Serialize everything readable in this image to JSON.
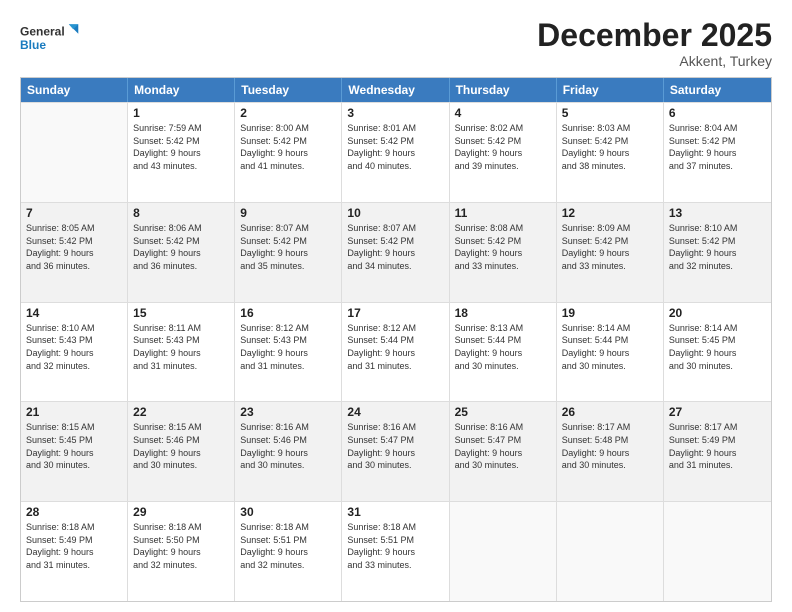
{
  "logo": {
    "text_general": "General",
    "text_blue": "Blue"
  },
  "title": "December 2025",
  "location": "Akkent, Turkey",
  "header_days": [
    "Sunday",
    "Monday",
    "Tuesday",
    "Wednesday",
    "Thursday",
    "Friday",
    "Saturday"
  ],
  "weeks": [
    [
      {
        "day": "",
        "lines": []
      },
      {
        "day": "1",
        "lines": [
          "Sunrise: 7:59 AM",
          "Sunset: 5:42 PM",
          "Daylight: 9 hours",
          "and 43 minutes."
        ]
      },
      {
        "day": "2",
        "lines": [
          "Sunrise: 8:00 AM",
          "Sunset: 5:42 PM",
          "Daylight: 9 hours",
          "and 41 minutes."
        ]
      },
      {
        "day": "3",
        "lines": [
          "Sunrise: 8:01 AM",
          "Sunset: 5:42 PM",
          "Daylight: 9 hours",
          "and 40 minutes."
        ]
      },
      {
        "day": "4",
        "lines": [
          "Sunrise: 8:02 AM",
          "Sunset: 5:42 PM",
          "Daylight: 9 hours",
          "and 39 minutes."
        ]
      },
      {
        "day": "5",
        "lines": [
          "Sunrise: 8:03 AM",
          "Sunset: 5:42 PM",
          "Daylight: 9 hours",
          "and 38 minutes."
        ]
      },
      {
        "day": "6",
        "lines": [
          "Sunrise: 8:04 AM",
          "Sunset: 5:42 PM",
          "Daylight: 9 hours",
          "and 37 minutes."
        ]
      }
    ],
    [
      {
        "day": "7",
        "lines": [
          "Sunrise: 8:05 AM",
          "Sunset: 5:42 PM",
          "Daylight: 9 hours",
          "and 36 minutes."
        ]
      },
      {
        "day": "8",
        "lines": [
          "Sunrise: 8:06 AM",
          "Sunset: 5:42 PM",
          "Daylight: 9 hours",
          "and 36 minutes."
        ]
      },
      {
        "day": "9",
        "lines": [
          "Sunrise: 8:07 AM",
          "Sunset: 5:42 PM",
          "Daylight: 9 hours",
          "and 35 minutes."
        ]
      },
      {
        "day": "10",
        "lines": [
          "Sunrise: 8:07 AM",
          "Sunset: 5:42 PM",
          "Daylight: 9 hours",
          "and 34 minutes."
        ]
      },
      {
        "day": "11",
        "lines": [
          "Sunrise: 8:08 AM",
          "Sunset: 5:42 PM",
          "Daylight: 9 hours",
          "and 33 minutes."
        ]
      },
      {
        "day": "12",
        "lines": [
          "Sunrise: 8:09 AM",
          "Sunset: 5:42 PM",
          "Daylight: 9 hours",
          "and 33 minutes."
        ]
      },
      {
        "day": "13",
        "lines": [
          "Sunrise: 8:10 AM",
          "Sunset: 5:42 PM",
          "Daylight: 9 hours",
          "and 32 minutes."
        ]
      }
    ],
    [
      {
        "day": "14",
        "lines": [
          "Sunrise: 8:10 AM",
          "Sunset: 5:43 PM",
          "Daylight: 9 hours",
          "and 32 minutes."
        ]
      },
      {
        "day": "15",
        "lines": [
          "Sunrise: 8:11 AM",
          "Sunset: 5:43 PM",
          "Daylight: 9 hours",
          "and 31 minutes."
        ]
      },
      {
        "day": "16",
        "lines": [
          "Sunrise: 8:12 AM",
          "Sunset: 5:43 PM",
          "Daylight: 9 hours",
          "and 31 minutes."
        ]
      },
      {
        "day": "17",
        "lines": [
          "Sunrise: 8:12 AM",
          "Sunset: 5:44 PM",
          "Daylight: 9 hours",
          "and 31 minutes."
        ]
      },
      {
        "day": "18",
        "lines": [
          "Sunrise: 8:13 AM",
          "Sunset: 5:44 PM",
          "Daylight: 9 hours",
          "and 30 minutes."
        ]
      },
      {
        "day": "19",
        "lines": [
          "Sunrise: 8:14 AM",
          "Sunset: 5:44 PM",
          "Daylight: 9 hours",
          "and 30 minutes."
        ]
      },
      {
        "day": "20",
        "lines": [
          "Sunrise: 8:14 AM",
          "Sunset: 5:45 PM",
          "Daylight: 9 hours",
          "and 30 minutes."
        ]
      }
    ],
    [
      {
        "day": "21",
        "lines": [
          "Sunrise: 8:15 AM",
          "Sunset: 5:45 PM",
          "Daylight: 9 hours",
          "and 30 minutes."
        ]
      },
      {
        "day": "22",
        "lines": [
          "Sunrise: 8:15 AM",
          "Sunset: 5:46 PM",
          "Daylight: 9 hours",
          "and 30 minutes."
        ]
      },
      {
        "day": "23",
        "lines": [
          "Sunrise: 8:16 AM",
          "Sunset: 5:46 PM",
          "Daylight: 9 hours",
          "and 30 minutes."
        ]
      },
      {
        "day": "24",
        "lines": [
          "Sunrise: 8:16 AM",
          "Sunset: 5:47 PM",
          "Daylight: 9 hours",
          "and 30 minutes."
        ]
      },
      {
        "day": "25",
        "lines": [
          "Sunrise: 8:16 AM",
          "Sunset: 5:47 PM",
          "Daylight: 9 hours",
          "and 30 minutes."
        ]
      },
      {
        "day": "26",
        "lines": [
          "Sunrise: 8:17 AM",
          "Sunset: 5:48 PM",
          "Daylight: 9 hours",
          "and 30 minutes."
        ]
      },
      {
        "day": "27",
        "lines": [
          "Sunrise: 8:17 AM",
          "Sunset: 5:49 PM",
          "Daylight: 9 hours",
          "and 31 minutes."
        ]
      }
    ],
    [
      {
        "day": "28",
        "lines": [
          "Sunrise: 8:18 AM",
          "Sunset: 5:49 PM",
          "Daylight: 9 hours",
          "and 31 minutes."
        ]
      },
      {
        "day": "29",
        "lines": [
          "Sunrise: 8:18 AM",
          "Sunset: 5:50 PM",
          "Daylight: 9 hours",
          "and 32 minutes."
        ]
      },
      {
        "day": "30",
        "lines": [
          "Sunrise: 8:18 AM",
          "Sunset: 5:51 PM",
          "Daylight: 9 hours",
          "and 32 minutes."
        ]
      },
      {
        "day": "31",
        "lines": [
          "Sunrise: 8:18 AM",
          "Sunset: 5:51 PM",
          "Daylight: 9 hours",
          "and 33 minutes."
        ]
      },
      {
        "day": "",
        "lines": []
      },
      {
        "day": "",
        "lines": []
      },
      {
        "day": "",
        "lines": []
      }
    ]
  ]
}
